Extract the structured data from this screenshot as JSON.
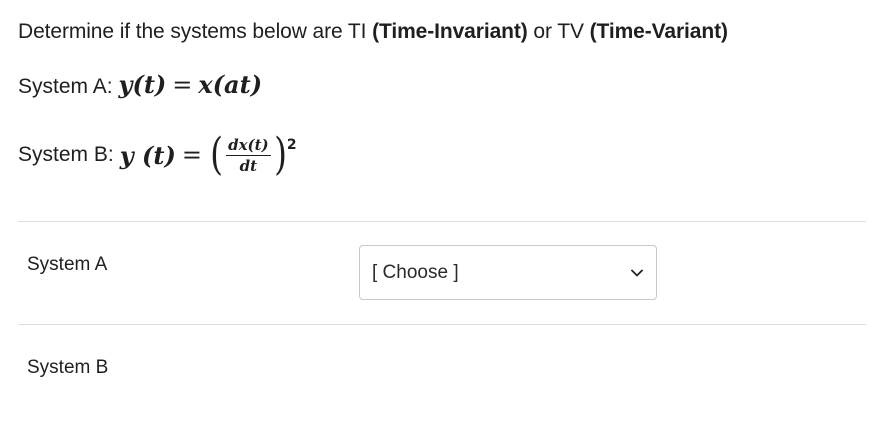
{
  "question": {
    "prefix": "Determine if the systems below are TI ",
    "ti_bold": "(Time-Invariant)",
    "middle": " or TV ",
    "tv_bold": "(Time-Variant)"
  },
  "system_a": {
    "label": "System A:",
    "lhs": "y(t)",
    "eq": "=",
    "rhs": "x(at)"
  },
  "system_b": {
    "label": "System B:",
    "lhs": "y (t)",
    "eq": "=",
    "open_paren": "(",
    "numerator": "dx(t)",
    "denominator": "dt",
    "close_paren": ")",
    "exponent": "2"
  },
  "rows": [
    {
      "label": "System A",
      "select_value": "[ Choose ]"
    },
    {
      "label": "System B"
    }
  ],
  "icons": {
    "dropdown": "chevron-down-icon"
  }
}
